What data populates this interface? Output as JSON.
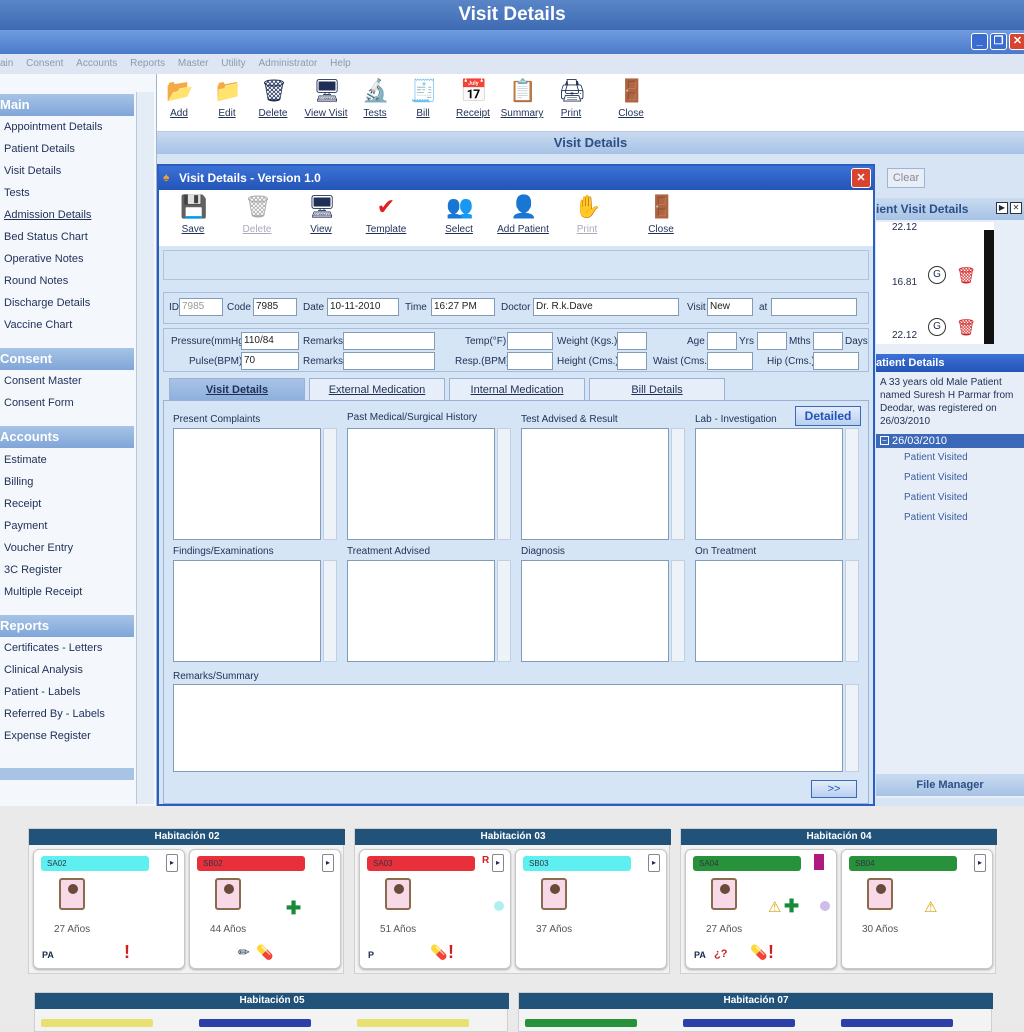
{
  "window": {
    "title": "Visit Details"
  },
  "menu": [
    "ain",
    "Consent",
    "Accounts",
    "Reports",
    "Master",
    "Utility",
    "Administrator",
    "Help"
  ],
  "sidebar": {
    "sections": [
      {
        "title": "Main",
        "items": [
          "Appointment Details",
          "Patient Details",
          "Visit Details",
          "Tests",
          "Admission Details",
          "Bed Status Chart",
          "Operative Notes",
          "Round Notes",
          "Discharge Details",
          "Vaccine Chart"
        ]
      },
      {
        "title": "Consent",
        "items": [
          "Consent Master",
          "Consent Form"
        ]
      },
      {
        "title": "Accounts",
        "items": [
          "Estimate",
          "Billing",
          "Receipt",
          "Payment",
          "Voucher Entry",
          "3C Register",
          "Multiple Receipt"
        ]
      },
      {
        "title": "Reports",
        "items": [
          "Certificates - Letters",
          "Clinical Analysis",
          "Patient - Labels",
          "Referred By - Labels",
          "Expense Register"
        ]
      }
    ]
  },
  "main_toolbar": [
    "Add",
    "Edit",
    "Delete",
    "View Visit",
    "Tests",
    "Bill",
    "Receipt",
    "Summary",
    "Print",
    "Close"
  ],
  "bg_window": {
    "title": "Visit Details",
    "clear": "Clear"
  },
  "right_panel": {
    "visit_title": "ient Visit Details",
    "values": [
      "22.12",
      "16.81",
      "22.12"
    ],
    "details_title": "atient Details",
    "details_text": "A 33 years old Male Patient named Suresh H Parmar from Deodar, was registered on 26/03/2010",
    "date": "26/03/2010",
    "visits": [
      "Patient Visited",
      "Patient Visited",
      "Patient Visited",
      "Patient Visited"
    ],
    "file_manager": "File Manager"
  },
  "dialog": {
    "title": "Visit Details - Version 1.0",
    "toolbar": [
      "Save",
      "Delete",
      "View",
      "Template",
      "Select",
      "Add Patient",
      "Print",
      "Close"
    ],
    "labels": {
      "id": "ID",
      "code": "Code",
      "date": "Date",
      "time": "Time",
      "doctor": "Doctor",
      "visit": "Visit",
      "at": "at",
      "pressure": "Pressure(mmHg)",
      "pulse": "Pulse(BPM)",
      "remarks": "Remarks",
      "temp": "Temp(°F)",
      "resp": "Resp.(BPM)",
      "weight": "Weight (Kgs.)",
      "height": "Height (Cms.)",
      "age": "Age",
      "yrs": "Yrs",
      "mths": "Mths",
      "days": "Days",
      "waist": "Waist (Cms.)",
      "hip": "Hip (Cms.)"
    },
    "values": {
      "id": "7985",
      "code": "7985",
      "date": "10-11-2010",
      "time": "16:27 PM",
      "doctor": "Dr. R.k.Dave",
      "visit": "New",
      "pressure": "110/84",
      "pulse": "70"
    },
    "tabs": [
      "Visit Details",
      "External Medication",
      "Internal Medication",
      "Bill Details"
    ],
    "sections": [
      "Present Complaints",
      "Past Medical/Surgical History",
      "Test Advised & Result",
      "Lab - Investigation",
      "Findings/Examinations",
      "Treatment Advised",
      "Diagnosis",
      "On Treatment",
      "Remarks/Summary"
    ],
    "detailed": "Detailed",
    "next": ">>"
  },
  "wards": [
    {
      "title": "Habitación 02",
      "beds": [
        {
          "tag": "SA02",
          "color": "#5ef0f0",
          "age": "27 Años",
          "code": "PA"
        },
        {
          "tag": "SB02",
          "color": "#e8303a",
          "age": "44 Años",
          "code": ""
        }
      ]
    },
    {
      "title": "Habitación 03",
      "beds": [
        {
          "tag": "SA03",
          "color": "#e8303a",
          "age": "51 Años",
          "code": "P"
        },
        {
          "tag": "SB03",
          "color": "#5ef0f0",
          "age": "37 Años",
          "code": ""
        }
      ]
    },
    {
      "title": "Habitación 04",
      "beds": [
        {
          "tag": "SA04",
          "color": "#28923a",
          "age": "27 Años",
          "code": "PA"
        },
        {
          "tag": "SB04",
          "color": "#28923a",
          "age": "30 Años",
          "code": ""
        }
      ]
    },
    {
      "title": "Habitación 05",
      "beds": []
    },
    {
      "title": "Habitación 07",
      "beds": []
    }
  ]
}
